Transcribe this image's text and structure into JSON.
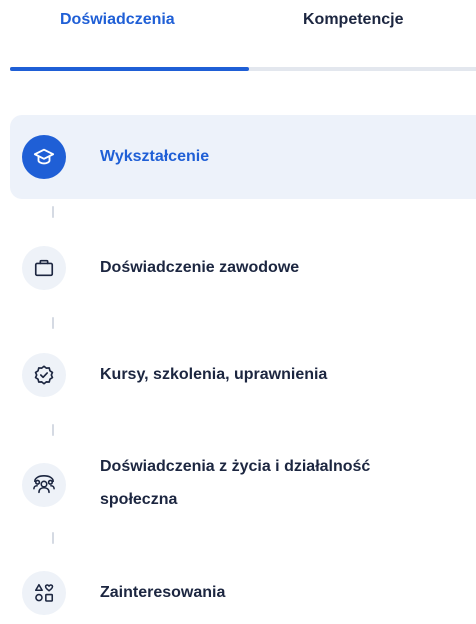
{
  "tabs": [
    {
      "label": "Doświadczenia",
      "active": true
    },
    {
      "label": "Kompetencje",
      "active": false
    }
  ],
  "steps": [
    {
      "label": "Wykształcenie",
      "icon": "graduation-cap-icon",
      "active": true
    },
    {
      "label": "Doświadczenie zawodowe",
      "icon": "briefcase-icon",
      "active": false
    },
    {
      "label": "Kursy, szkolenia, uprawnienia",
      "icon": "badge-check-icon",
      "active": false
    },
    {
      "label_line1": "Doświadczenia z życia i działalność",
      "label_line2": "społeczna",
      "icon": "people-group-icon",
      "active": false
    },
    {
      "label": "Zainteresowania",
      "icon": "shapes-icon",
      "active": false
    }
  ],
  "colors": {
    "accent": "#1f5fd6",
    "text": "#1c2640",
    "active_bg": "#edf2fa",
    "icon_bg": "#eef2f8",
    "connector": "#d5dae3"
  }
}
